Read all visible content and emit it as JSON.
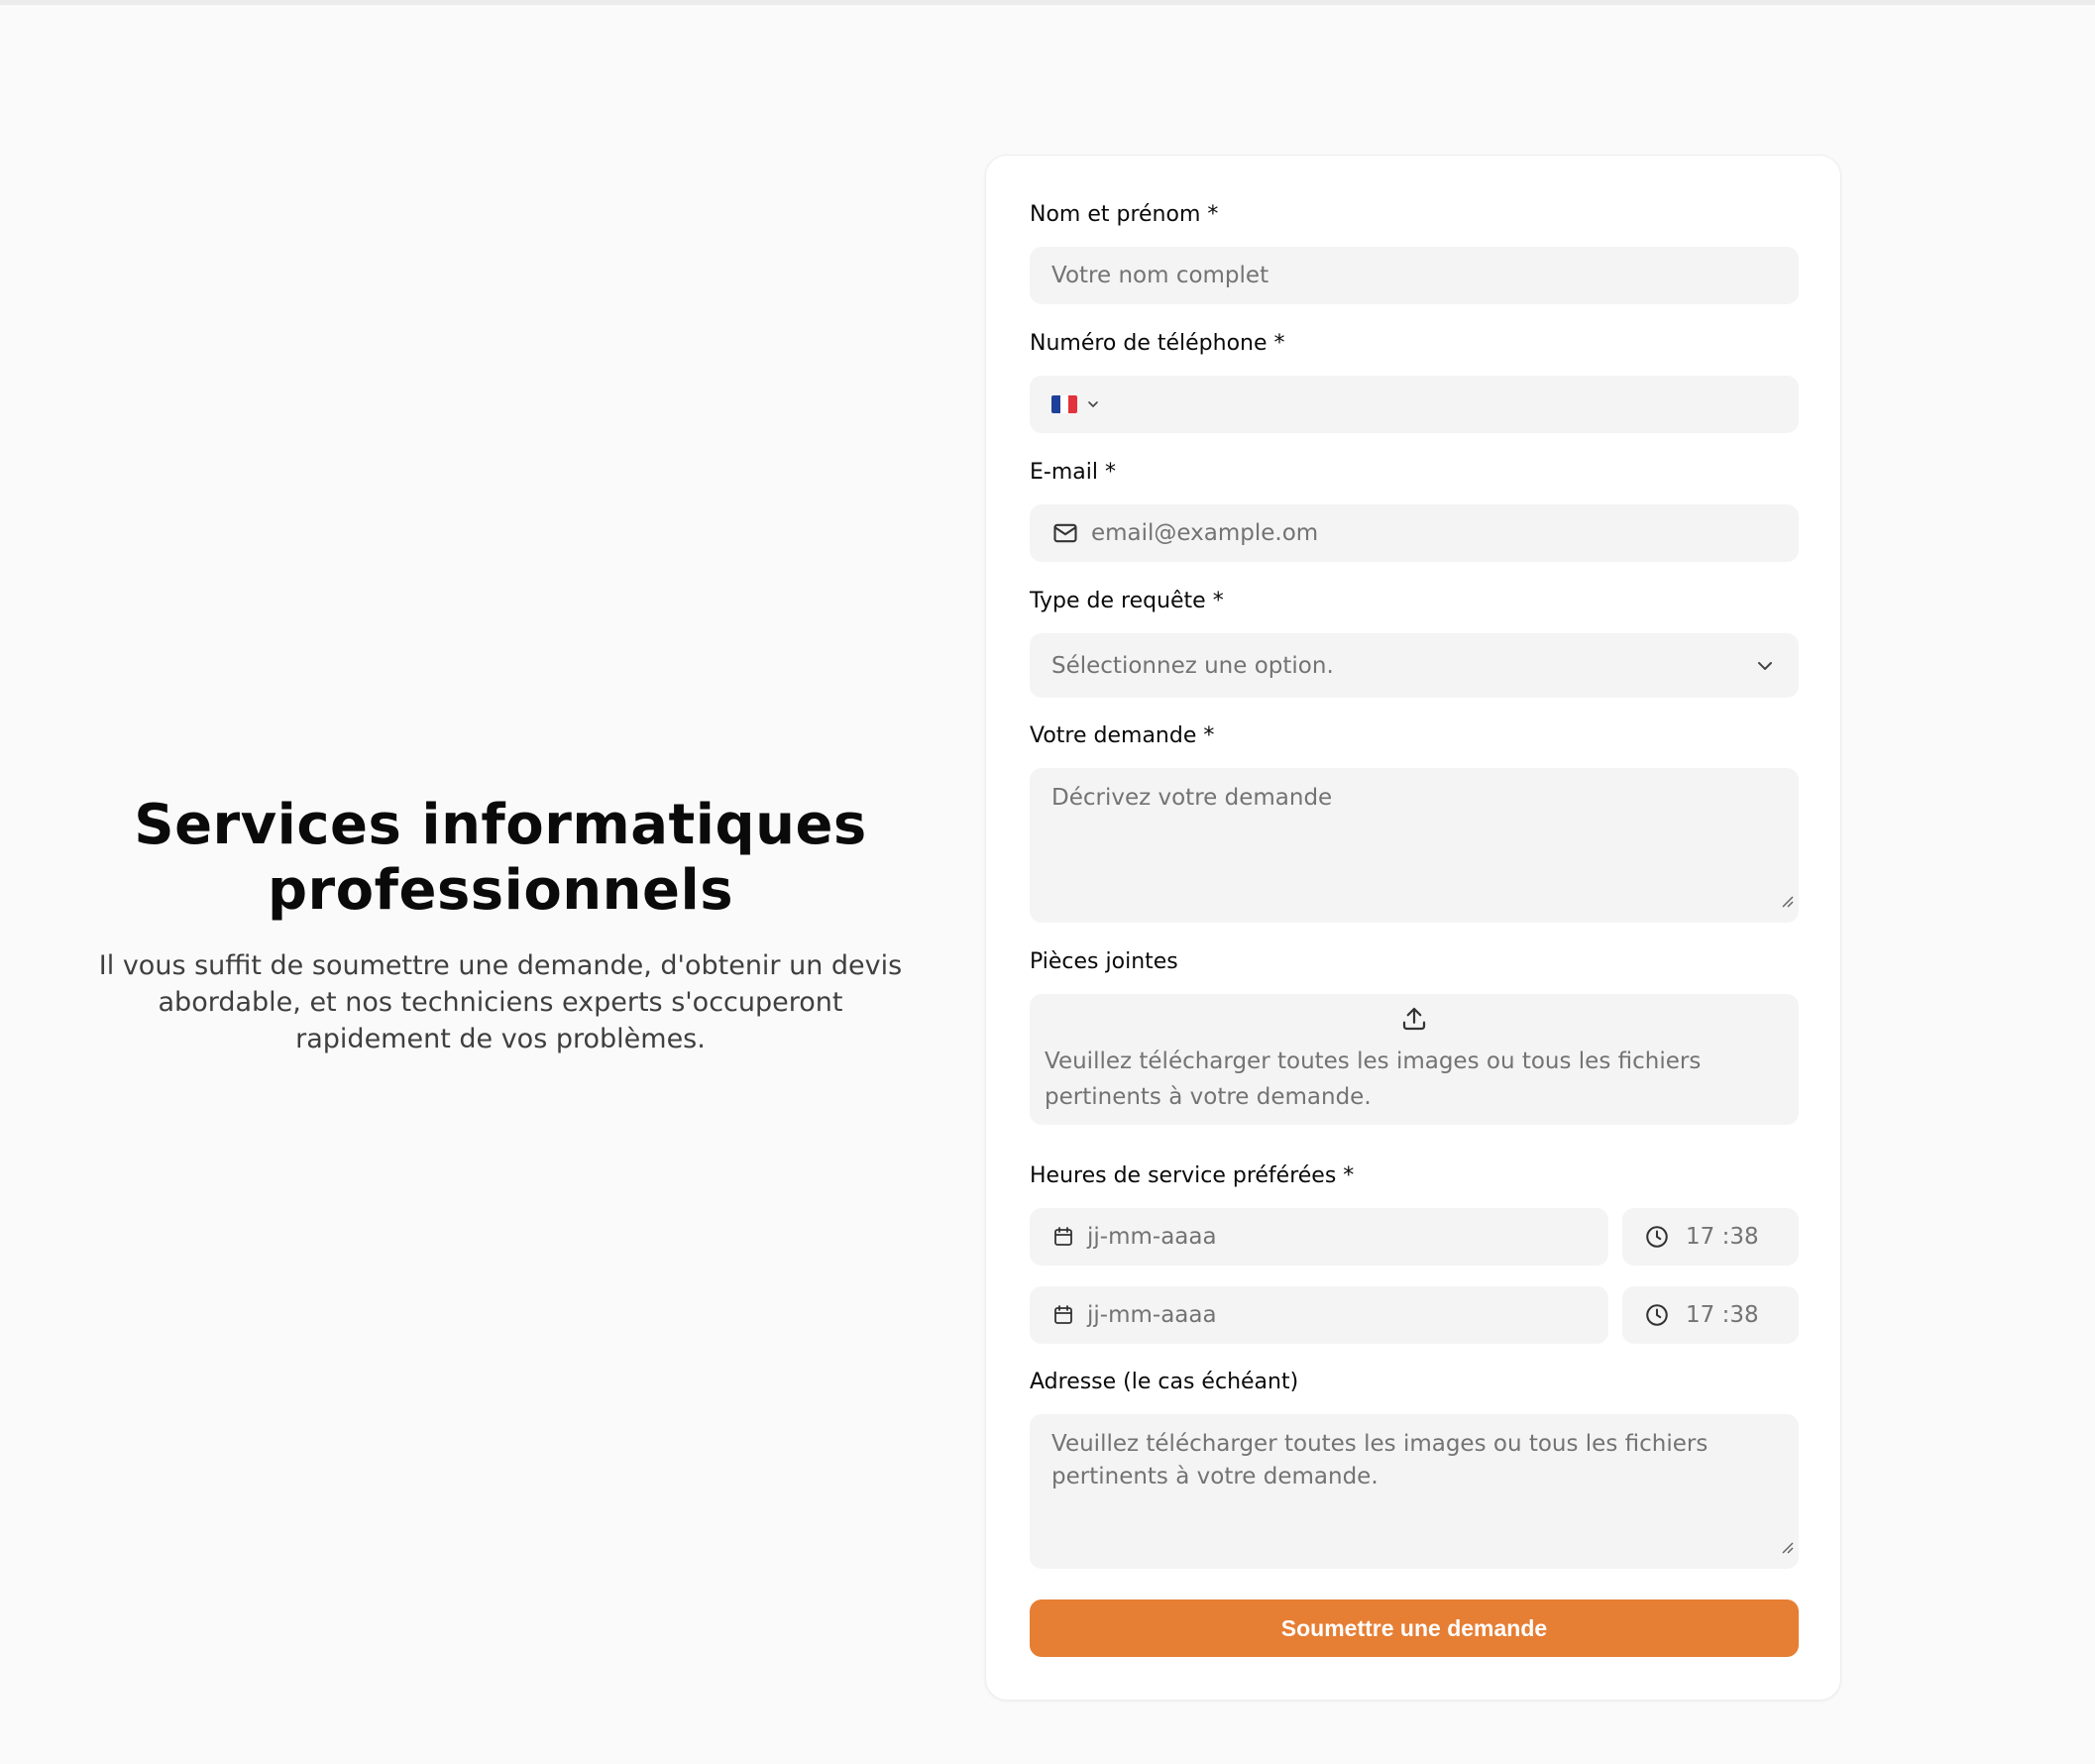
{
  "hero": {
    "title_line1": "Services informatiques",
    "title_line2": "professionnels",
    "subtitle_line1": "Il vous suffit de soumettre une demande, d'obtenir un devis",
    "subtitle_line2": "abordable, et nos techniciens experts s'occuperont",
    "subtitle_line3": "rapidement de vos problèmes."
  },
  "form": {
    "name": {
      "label": "Nom et prénom *",
      "placeholder": "Votre nom complet"
    },
    "phone": {
      "label": "Numéro de téléphone *",
      "country_flag": "flag-france-icon"
    },
    "email": {
      "label": "E-mail *",
      "placeholder": "email@example.om",
      "icon": "mail-icon"
    },
    "request_type": {
      "label": "Type de requête *",
      "placeholder": "Sélectionnez une option."
    },
    "request": {
      "label": "Votre demande *",
      "placeholder": "Décrivez votre demande"
    },
    "attachments": {
      "label": "Pièces jointes",
      "hint": "Veuillez télécharger toutes les images ou tous les fichiers pertinents à votre demande."
    },
    "service_hours": {
      "label": "Heures de service préférées *",
      "slots": [
        {
          "date_placeholder": "jj-mm-aaaa",
          "time": "17 :38"
        },
        {
          "date_placeholder": "jj-mm-aaaa",
          "time": "17 :38"
        }
      ]
    },
    "address": {
      "label": "Adresse (le cas échéant)",
      "placeholder": "Veuillez télécharger toutes les images ou tous les fichiers pertinents à votre demande."
    },
    "submit_label": "Soumettre une demande"
  },
  "colors": {
    "accent": "#e67e34",
    "field_bg": "#f4f4f4",
    "page_bg": "#fafafa"
  }
}
